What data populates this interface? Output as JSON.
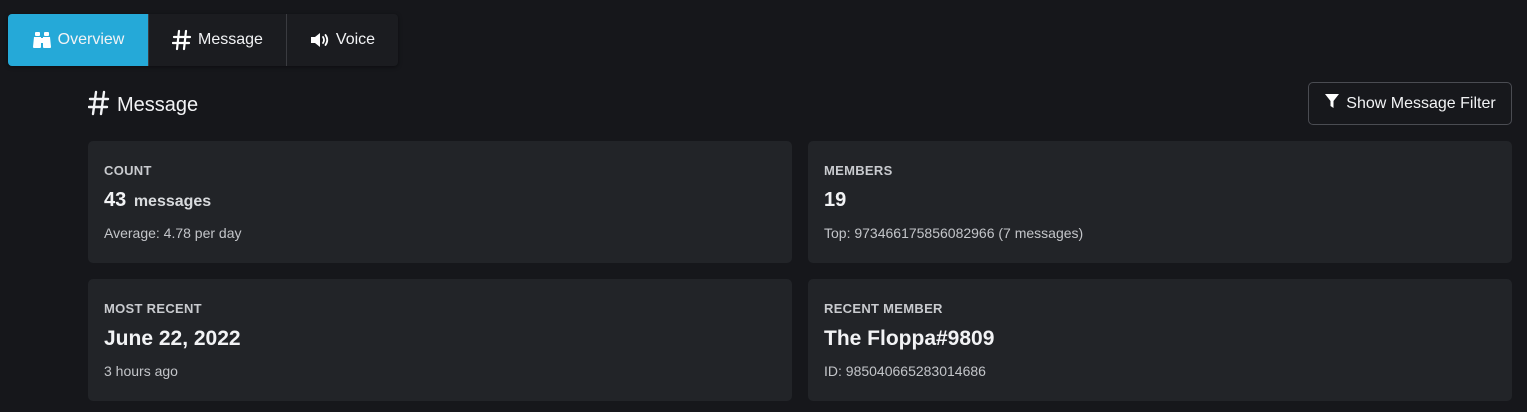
{
  "tabs": [
    {
      "label": "Overview",
      "icon": "binoculars-icon",
      "active": true
    },
    {
      "label": "Message",
      "icon": "hashtag-icon",
      "active": false
    },
    {
      "label": "Voice",
      "icon": "volume-icon",
      "active": false
    }
  ],
  "section": {
    "title": "Message",
    "icon": "hashtag-icon",
    "filter_button": "Show Message Filter"
  },
  "cards": {
    "count": {
      "label": "COUNT",
      "value": "43",
      "unit": "messages",
      "sub": "Average: 4.78 per day"
    },
    "members": {
      "label": "MEMBERS",
      "value": "19",
      "sub": "Top: 973466175856082966 (7 messages)"
    },
    "most_recent": {
      "label": "MOST RECENT",
      "value": "June 22, 2022",
      "sub": "3 hours ago"
    },
    "recent_member": {
      "label": "RECENT MEMBER",
      "value": "The Floppa#9809",
      "sub": "ID: 985040665283014686"
    }
  },
  "colors": {
    "background": "#16171b",
    "card": "#222428",
    "accent": "#25a9d8"
  }
}
